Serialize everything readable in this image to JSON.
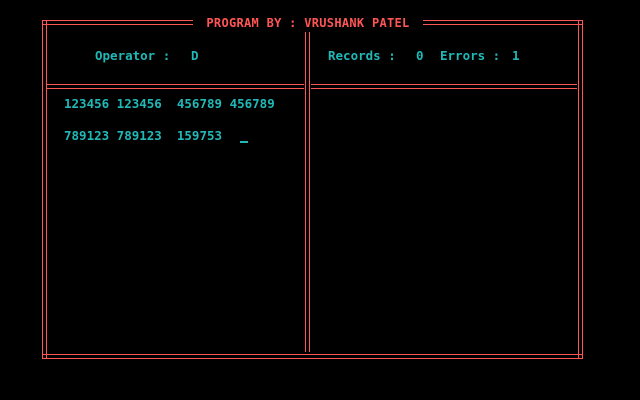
{
  "header": {
    "title": "PROGRAM BY : VRUSHANK PATEL"
  },
  "left_panel": {
    "operator_label": "Operator :",
    "operator_value": "D",
    "lines": [
      "123456 123456  456789 456789",
      "789123 789123  159753"
    ]
  },
  "right_panel": {
    "records_label": "Records :",
    "records_value": "0",
    "errors_label": "Errors :",
    "errors_value": "1"
  },
  "colors": {
    "background": "#000000",
    "border": "#ff5555",
    "text": "#22b8b8"
  }
}
